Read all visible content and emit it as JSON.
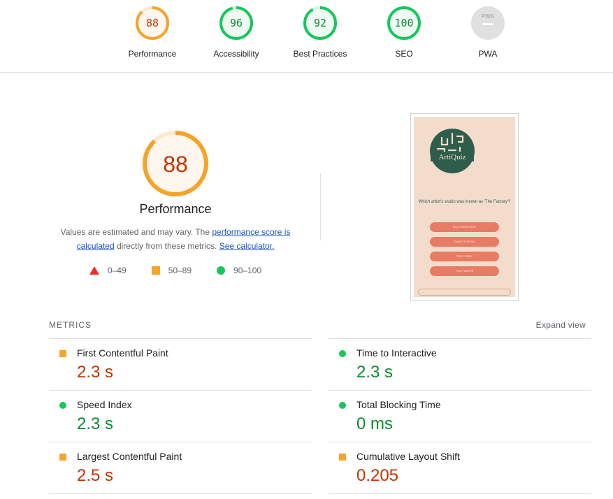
{
  "colors": {
    "average": "#f6a32c",
    "average_text": "#c33300",
    "pass": "#16c75b",
    "pass_text": "#0a8a2e",
    "fail": "#eb3223",
    "link": "#1a55c9",
    "pwa_gray": "#e0e0e0"
  },
  "gauges": [
    {
      "score": "88",
      "label": "Performance",
      "fraction": 0.88,
      "status": "average"
    },
    {
      "score": "96",
      "label": "Accessibility",
      "fraction": 0.96,
      "status": "pass"
    },
    {
      "score": "92",
      "label": "Best Practices",
      "fraction": 0.92,
      "status": "pass"
    },
    {
      "score": "100",
      "label": "SEO",
      "fraction": 1.0,
      "status": "pass"
    },
    {
      "score": "PWA",
      "label": "PWA",
      "fraction": 0,
      "status": "na"
    }
  ],
  "performance": {
    "score": "88",
    "fraction": 0.88,
    "title": "Performance",
    "desc_prefix": "Values are estimated and may vary. The ",
    "link_score": "performance score is calculated",
    "desc_middle": " directly from these metrics. ",
    "link_calc": "See calculator.",
    "legend": {
      "fail": "0–49",
      "average": "50–89",
      "pass": "90–100"
    }
  },
  "thumbnail": {
    "logo_text": "ArtiQuiz",
    "question": "Which artist's studio was known as 'The Factory'?",
    "answers": [
      "Roy Lichtenstein",
      "David Hockney",
      "Peter Blake",
      "Andy Warhol"
    ]
  },
  "metrics": {
    "title": "METRICS",
    "expand_label": "Expand view",
    "items": [
      {
        "name": "First Contentful Paint",
        "value": "2.3 s",
        "status": "orange"
      },
      {
        "name": "Time to Interactive",
        "value": "2.3 s",
        "status": "green"
      },
      {
        "name": "Speed Index",
        "value": "2.3 s",
        "status": "green"
      },
      {
        "name": "Total Blocking Time",
        "value": "0 ms",
        "status": "green"
      },
      {
        "name": "Largest Contentful Paint",
        "value": "2.5 s",
        "status": "orange"
      },
      {
        "name": "Cumulative Layout Shift",
        "value": "0.205",
        "status": "orange"
      }
    ]
  }
}
